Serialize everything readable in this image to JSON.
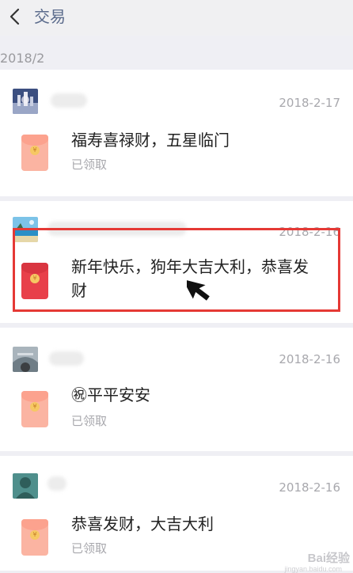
{
  "header": {
    "title": "交易",
    "back_icon": "chevron-left-icon"
  },
  "month_label": "2018/2",
  "transactions": [
    {
      "date": "2018-2-17",
      "blessing_lines": [
        "福寿喜禄财，五星临门"
      ],
      "status": "已领取",
      "avatar": "city-night-avatar",
      "envelope": "red-packet-icon"
    },
    {
      "date": "2018-2-16",
      "blessing_lines": [
        "新年快乐，狗年大吉大利，恭喜发",
        "财"
      ],
      "status": "",
      "avatar": "beach-avatar",
      "envelope": "red-packet-icon",
      "highlighted": true
    },
    {
      "date": "2018-2-16",
      "blessing_lines": [
        "㊗平平安安"
      ],
      "status": "已领取",
      "avatar": "bridge-avatar",
      "envelope": "red-packet-icon"
    },
    {
      "date": "2018-2-16",
      "blessing_lines": [
        "恭喜发财，大吉大利"
      ],
      "status": "已领取",
      "avatar": "silhouette-avatar",
      "envelope": "red-packet-icon"
    }
  ],
  "colors": {
    "accent_red": "#e53935",
    "header_text": "#5b6b8c",
    "envelope_active": "#e8404a",
    "envelope_faded": "#fbb4a2"
  },
  "watermark": {
    "brand": "Bai经验",
    "url": "jingyan.baidu.com"
  }
}
